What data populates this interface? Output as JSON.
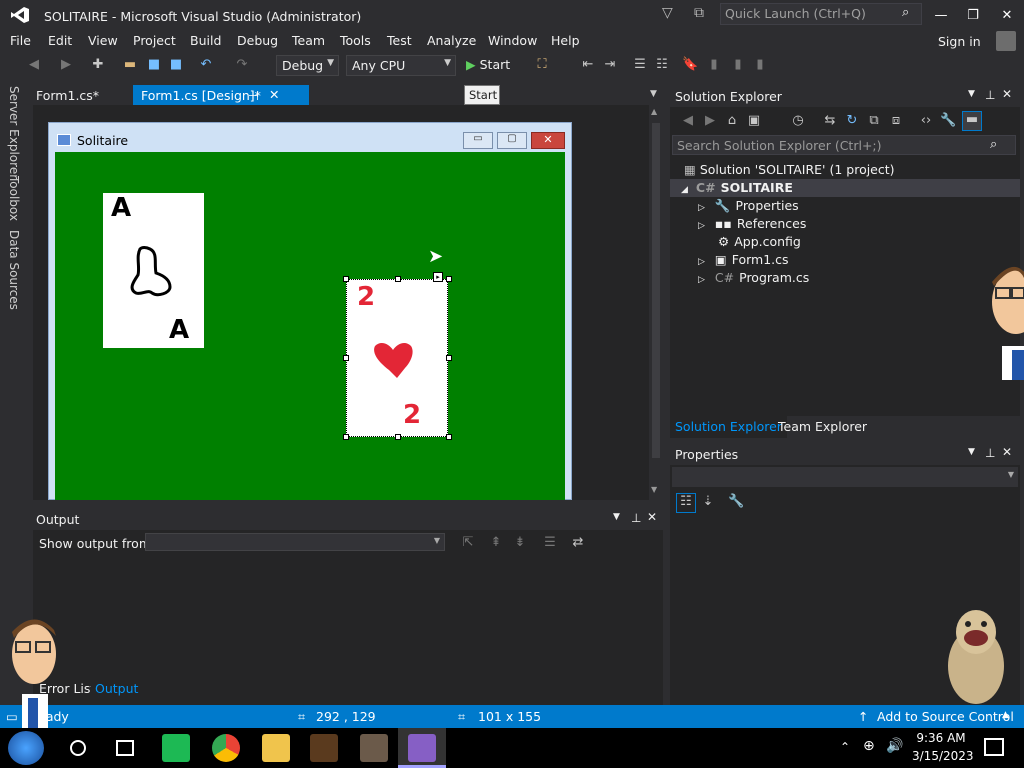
{
  "window": {
    "title": "SOLITAIRE - Microsoft Visual Studio  (Administrator)",
    "quick_launch_placeholder": "Quick Launch (Ctrl+Q)"
  },
  "menu": [
    "File",
    "Edit",
    "View",
    "Project",
    "Build",
    "Debug",
    "Team",
    "Tools",
    "Test",
    "Analyze",
    "Window",
    "Help"
  ],
  "sign_in": "Sign in",
  "toolbar": {
    "config": "Debug",
    "platform": "Any CPU",
    "start": "Start",
    "tooltip": "Start"
  },
  "left_tabs": [
    "Server Explorer",
    "Toolbox",
    "Data Sources"
  ],
  "doc_tabs": [
    {
      "label": "Form1.cs*"
    },
    {
      "label": "Form1.cs [Design]*",
      "active": true
    }
  ],
  "form": {
    "title": "Solitaire",
    "cards": [
      {
        "top": "A",
        "bottom": "A"
      },
      {
        "top": "2",
        "bottom": "2"
      }
    ]
  },
  "output": {
    "title": "Output",
    "show_output_from": "Show output from:"
  },
  "bottom_tabs": [
    "Error List",
    "Output"
  ],
  "solution_explorer": {
    "title": "Solution Explorer",
    "search_placeholder": "Search Solution Explorer (Ctrl+;)",
    "solution": "Solution 'SOLITAIRE' (1 project)",
    "project": "SOLITAIRE",
    "items": [
      "Properties",
      "References",
      "App.config",
      "Form1.cs",
      "Program.cs"
    ],
    "tabs": [
      "Solution Explorer",
      "Team Explorer"
    ]
  },
  "properties": {
    "title": "Properties"
  },
  "status": {
    "left": "Ready",
    "position": "292 , 129",
    "size": "101 x 155",
    "source_control": "Add to Source Control"
  },
  "taskbar": {
    "time": "9:36 AM",
    "date": "3/15/2023"
  },
  "colors": {
    "accent": "#007acc",
    "form_bg": "#008000",
    "hearts": "#e32636"
  }
}
